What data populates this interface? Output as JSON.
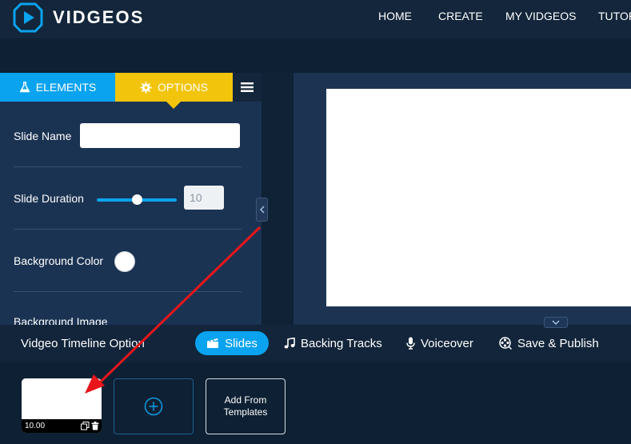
{
  "brand": {
    "name": "VIDGEOS"
  },
  "nav": {
    "items": [
      "HOME",
      "CREATE",
      "MY VIDGEOS",
      "TUTORIALS"
    ]
  },
  "panel": {
    "tabs": {
      "elements": "ELEMENTS",
      "options": "OPTIONS"
    },
    "active_tab": "OPTIONS",
    "fields": {
      "slide_name_label": "Slide Name",
      "slide_name_value": "",
      "slide_duration_label": "Slide Duration",
      "slide_duration_value": "10",
      "slide_duration_slider_fraction": 0.5,
      "background_color_label": "Background Color",
      "background_color_value": "#ffffff",
      "background_image_label": "Background Image"
    }
  },
  "timeline": {
    "title": "Vidgeo Timeline Option",
    "tabs": {
      "slides": "Slides",
      "backing_tracks": "Backing Tracks",
      "voiceover": "Voiceover",
      "save_publish": "Save & Publish"
    },
    "active_tab": "Slides"
  },
  "slides": {
    "items": [
      {
        "duration": "10.00"
      }
    ],
    "add_from_templates_line1": "Add From",
    "add_from_templates_line2": "Templates"
  },
  "colors": {
    "accent_blue": "#0aa3ef",
    "accent_yellow": "#f2c40c",
    "panel_bg": "#1b3352",
    "annotation_arrow": "#e8161b"
  }
}
